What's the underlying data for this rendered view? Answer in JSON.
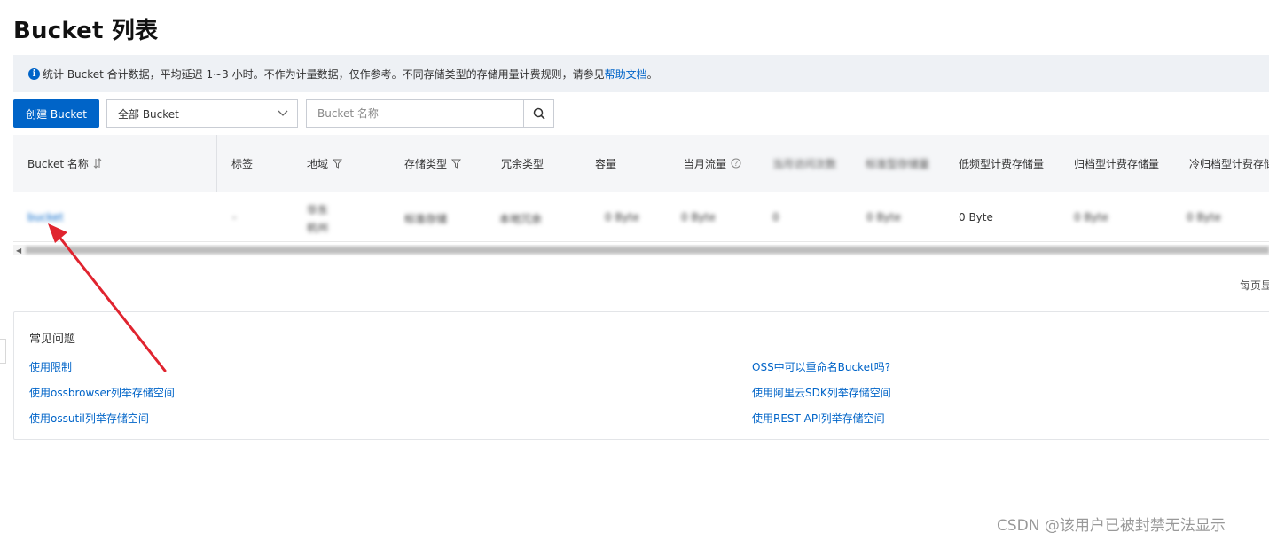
{
  "page": {
    "title": "Bucket 列表"
  },
  "notice": {
    "text": "统计 Bucket 合计数据，平均延迟 1~3 小时。不作为计量数据，仅作参考。不同存储类型的存储用量计费规则，请参见",
    "link": "帮助文档",
    "suffix": "。"
  },
  "toolbar": {
    "create_label": "创建 Bucket",
    "filter_value": "全部 Bucket",
    "search_placeholder": "Bucket 名称"
  },
  "table": {
    "columns": [
      "Bucket 名称",
      "标签",
      "地域",
      "存储类型",
      "冗余类型",
      "容量",
      "当月流量",
      "当月访问次数",
      "标准型存储量",
      "低频型计费存储量",
      "归档型计费存储量",
      "冷归档型计费存储"
    ],
    "row": {
      "bucket_name": "bucket",
      "tag": "-",
      "region_line1": "华东",
      "region_line2": "杭州",
      "storage_class": "标准存储",
      "redundancy": "本地冗余",
      "capacity": "0 Byte",
      "monthly_traffic": "0 Byte",
      "monthly_requests": "0",
      "standard_storage": "0 Byte",
      "ia_storage": "0 Byte",
      "archive_storage": "0 Byte",
      "cold_archive_storage": "0 Byte"
    }
  },
  "pagination": {
    "per_page_label": "每页显"
  },
  "faq": {
    "title": "常见问题",
    "links_left": [
      "使用限制",
      "使用ossbrowser列举存储空间",
      "使用ossutil列举存储空间"
    ],
    "links_right": [
      "OSS中可以重命名Bucket吗?",
      "使用阿里云SDK列举存储空间",
      "使用REST API列举存储空间"
    ]
  },
  "watermark": "CSDN @该用户已被封禁无法显示",
  "colors": {
    "primary": "#0064c8",
    "annotation_arrow": "#e0242f"
  }
}
